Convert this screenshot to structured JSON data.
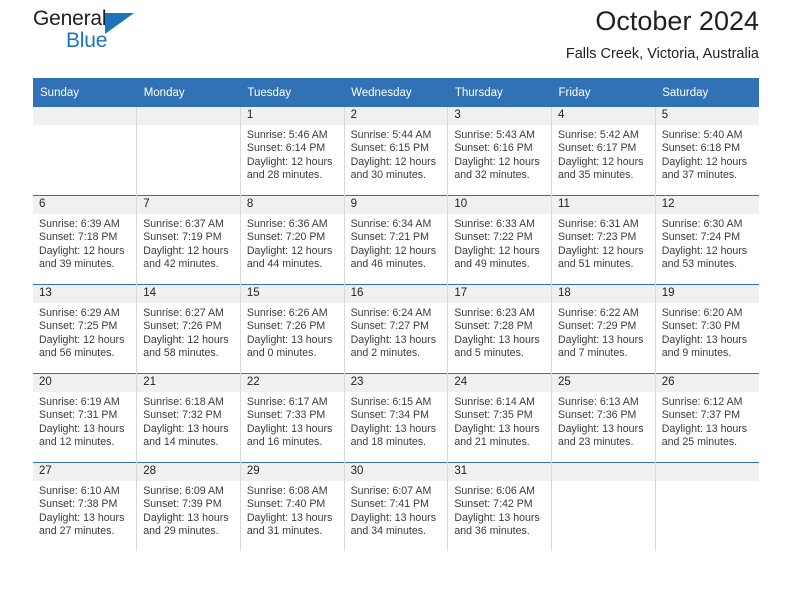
{
  "brand": {
    "name_top": "General",
    "name_bottom": "Blue",
    "triangle_color": "#1b75bb"
  },
  "header": {
    "title": "October 2024",
    "subtitle": "Falls Creek, Victoria, Australia",
    "accent_color": "#3072b5"
  },
  "calendar": {
    "weekday_headers": [
      "Sunday",
      "Monday",
      "Tuesday",
      "Wednesday",
      "Thursday",
      "Friday",
      "Saturday"
    ],
    "weeks": [
      [
        {
          "day": "",
          "sunrise": "",
          "sunset": "",
          "daylight_1": "",
          "daylight_2": ""
        },
        {
          "day": "",
          "sunrise": "",
          "sunset": "",
          "daylight_1": "",
          "daylight_2": ""
        },
        {
          "day": "1",
          "sunrise": "Sunrise: 5:46 AM",
          "sunset": "Sunset: 6:14 PM",
          "daylight_1": "Daylight: 12 hours",
          "daylight_2": "and 28 minutes."
        },
        {
          "day": "2",
          "sunrise": "Sunrise: 5:44 AM",
          "sunset": "Sunset: 6:15 PM",
          "daylight_1": "Daylight: 12 hours",
          "daylight_2": "and 30 minutes."
        },
        {
          "day": "3",
          "sunrise": "Sunrise: 5:43 AM",
          "sunset": "Sunset: 6:16 PM",
          "daylight_1": "Daylight: 12 hours",
          "daylight_2": "and 32 minutes."
        },
        {
          "day": "4",
          "sunrise": "Sunrise: 5:42 AM",
          "sunset": "Sunset: 6:17 PM",
          "daylight_1": "Daylight: 12 hours",
          "daylight_2": "and 35 minutes."
        },
        {
          "day": "5",
          "sunrise": "Sunrise: 5:40 AM",
          "sunset": "Sunset: 6:18 PM",
          "daylight_1": "Daylight: 12 hours",
          "daylight_2": "and 37 minutes."
        }
      ],
      [
        {
          "day": "6",
          "sunrise": "Sunrise: 6:39 AM",
          "sunset": "Sunset: 7:18 PM",
          "daylight_1": "Daylight: 12 hours",
          "daylight_2": "and 39 minutes."
        },
        {
          "day": "7",
          "sunrise": "Sunrise: 6:37 AM",
          "sunset": "Sunset: 7:19 PM",
          "daylight_1": "Daylight: 12 hours",
          "daylight_2": "and 42 minutes."
        },
        {
          "day": "8",
          "sunrise": "Sunrise: 6:36 AM",
          "sunset": "Sunset: 7:20 PM",
          "daylight_1": "Daylight: 12 hours",
          "daylight_2": "and 44 minutes."
        },
        {
          "day": "9",
          "sunrise": "Sunrise: 6:34 AM",
          "sunset": "Sunset: 7:21 PM",
          "daylight_1": "Daylight: 12 hours",
          "daylight_2": "and 46 minutes."
        },
        {
          "day": "10",
          "sunrise": "Sunrise: 6:33 AM",
          "sunset": "Sunset: 7:22 PM",
          "daylight_1": "Daylight: 12 hours",
          "daylight_2": "and 49 minutes."
        },
        {
          "day": "11",
          "sunrise": "Sunrise: 6:31 AM",
          "sunset": "Sunset: 7:23 PM",
          "daylight_1": "Daylight: 12 hours",
          "daylight_2": "and 51 minutes."
        },
        {
          "day": "12",
          "sunrise": "Sunrise: 6:30 AM",
          "sunset": "Sunset: 7:24 PM",
          "daylight_1": "Daylight: 12 hours",
          "daylight_2": "and 53 minutes."
        }
      ],
      [
        {
          "day": "13",
          "sunrise": "Sunrise: 6:29 AM",
          "sunset": "Sunset: 7:25 PM",
          "daylight_1": "Daylight: 12 hours",
          "daylight_2": "and 56 minutes."
        },
        {
          "day": "14",
          "sunrise": "Sunrise: 6:27 AM",
          "sunset": "Sunset: 7:26 PM",
          "daylight_1": "Daylight: 12 hours",
          "daylight_2": "and 58 minutes."
        },
        {
          "day": "15",
          "sunrise": "Sunrise: 6:26 AM",
          "sunset": "Sunset: 7:26 PM",
          "daylight_1": "Daylight: 13 hours",
          "daylight_2": "and 0 minutes."
        },
        {
          "day": "16",
          "sunrise": "Sunrise: 6:24 AM",
          "sunset": "Sunset: 7:27 PM",
          "daylight_1": "Daylight: 13 hours",
          "daylight_2": "and 2 minutes."
        },
        {
          "day": "17",
          "sunrise": "Sunrise: 6:23 AM",
          "sunset": "Sunset: 7:28 PM",
          "daylight_1": "Daylight: 13 hours",
          "daylight_2": "and 5 minutes."
        },
        {
          "day": "18",
          "sunrise": "Sunrise: 6:22 AM",
          "sunset": "Sunset: 7:29 PM",
          "daylight_1": "Daylight: 13 hours",
          "daylight_2": "and 7 minutes."
        },
        {
          "day": "19",
          "sunrise": "Sunrise: 6:20 AM",
          "sunset": "Sunset: 7:30 PM",
          "daylight_1": "Daylight: 13 hours",
          "daylight_2": "and 9 minutes."
        }
      ],
      [
        {
          "day": "20",
          "sunrise": "Sunrise: 6:19 AM",
          "sunset": "Sunset: 7:31 PM",
          "daylight_1": "Daylight: 13 hours",
          "daylight_2": "and 12 minutes."
        },
        {
          "day": "21",
          "sunrise": "Sunrise: 6:18 AM",
          "sunset": "Sunset: 7:32 PM",
          "daylight_1": "Daylight: 13 hours",
          "daylight_2": "and 14 minutes."
        },
        {
          "day": "22",
          "sunrise": "Sunrise: 6:17 AM",
          "sunset": "Sunset: 7:33 PM",
          "daylight_1": "Daylight: 13 hours",
          "daylight_2": "and 16 minutes."
        },
        {
          "day": "23",
          "sunrise": "Sunrise: 6:15 AM",
          "sunset": "Sunset: 7:34 PM",
          "daylight_1": "Daylight: 13 hours",
          "daylight_2": "and 18 minutes."
        },
        {
          "day": "24",
          "sunrise": "Sunrise: 6:14 AM",
          "sunset": "Sunset: 7:35 PM",
          "daylight_1": "Daylight: 13 hours",
          "daylight_2": "and 21 minutes."
        },
        {
          "day": "25",
          "sunrise": "Sunrise: 6:13 AM",
          "sunset": "Sunset: 7:36 PM",
          "daylight_1": "Daylight: 13 hours",
          "daylight_2": "and 23 minutes."
        },
        {
          "day": "26",
          "sunrise": "Sunrise: 6:12 AM",
          "sunset": "Sunset: 7:37 PM",
          "daylight_1": "Daylight: 13 hours",
          "daylight_2": "and 25 minutes."
        }
      ],
      [
        {
          "day": "27",
          "sunrise": "Sunrise: 6:10 AM",
          "sunset": "Sunset: 7:38 PM",
          "daylight_1": "Daylight: 13 hours",
          "daylight_2": "and 27 minutes."
        },
        {
          "day": "28",
          "sunrise": "Sunrise: 6:09 AM",
          "sunset": "Sunset: 7:39 PM",
          "daylight_1": "Daylight: 13 hours",
          "daylight_2": "and 29 minutes."
        },
        {
          "day": "29",
          "sunrise": "Sunrise: 6:08 AM",
          "sunset": "Sunset: 7:40 PM",
          "daylight_1": "Daylight: 13 hours",
          "daylight_2": "and 31 minutes."
        },
        {
          "day": "30",
          "sunrise": "Sunrise: 6:07 AM",
          "sunset": "Sunset: 7:41 PM",
          "daylight_1": "Daylight: 13 hours",
          "daylight_2": "and 34 minutes."
        },
        {
          "day": "31",
          "sunrise": "Sunrise: 6:06 AM",
          "sunset": "Sunset: 7:42 PM",
          "daylight_1": "Daylight: 13 hours",
          "daylight_2": "and 36 minutes."
        },
        {
          "day": "",
          "sunrise": "",
          "sunset": "",
          "daylight_1": "",
          "daylight_2": ""
        },
        {
          "day": "",
          "sunrise": "",
          "sunset": "",
          "daylight_1": "",
          "daylight_2": ""
        }
      ]
    ]
  }
}
